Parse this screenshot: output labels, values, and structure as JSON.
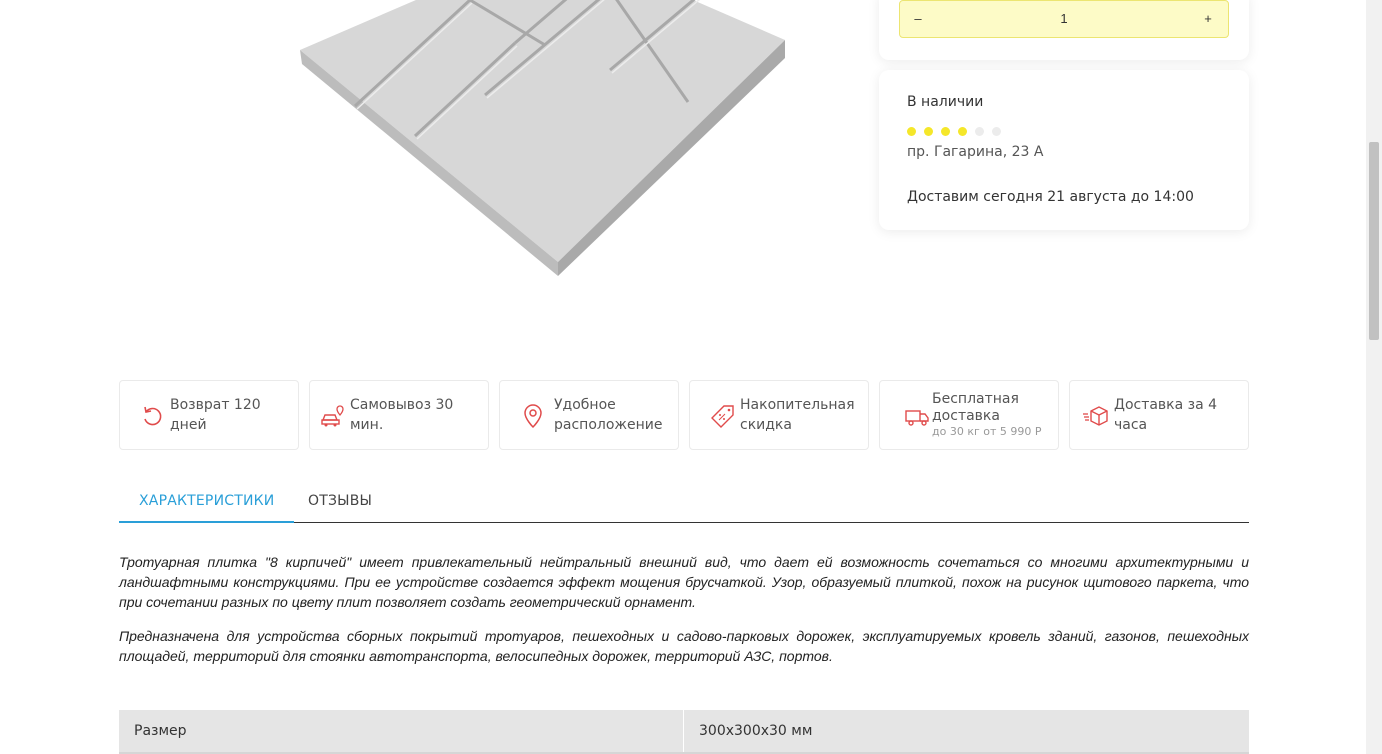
{
  "quantity": {
    "minus": "–",
    "value": "1",
    "plus": "+"
  },
  "availability": {
    "status": "В наличии",
    "stock_level": {
      "filled": 4,
      "total": 6
    },
    "address": "пр. Гагарина, 23 А",
    "delivery": "Доставим сегодня 21 августа до 14:00"
  },
  "colors": {
    "accent": "#2a9fd8",
    "stock_dot": "#f5e72a",
    "stepper_bg": "#fdfbc7",
    "icon": "#e04b4b"
  },
  "benefits": [
    {
      "icon": "return-icon",
      "label": "Возврат 120 дней"
    },
    {
      "icon": "car-location-icon",
      "label": "Самовывоз 30 мин."
    },
    {
      "icon": "location-pin-icon",
      "label": "Удобное расположение"
    },
    {
      "icon": "discount-tag-icon",
      "label": "Накопительная скидка"
    },
    {
      "icon": "delivery-truck-icon",
      "label": "Бесплатная доставка",
      "sublabel": "до 30 кг от 5 990 Р"
    },
    {
      "icon": "fast-box-icon",
      "label": "Доставка за 4 часа"
    }
  ],
  "tabs": [
    {
      "label": "ХАРАКТЕРИСТИКИ",
      "active": true
    },
    {
      "label": "ОТЗЫВЫ",
      "active": false
    }
  ],
  "description": [
    "Тротуарная плитка \"8 кирпичей\" имеет привлекательный нейтральный внешний вид, что дает ей возможность сочетаться со многими архитектурными и ландшафтными конструкциями. При ее устройстве создается эффект мощения брусчаткой. Узор, образуемый плиткой, похож на рисунок щитового паркета, что при сочетании разных по цвету плит позволяет создать геометрический орнамент.",
    "Предназначена для устройства сборных покрытий тротуаров, пешеходных и садово-парковых дорожек, эксплуатируемых кровель зданий, газонов, пешеходных площадей, территорий для стоянки автотранспорта, велосипедных дорожек, территорий АЗС, портов."
  ],
  "specs": [
    {
      "key": "Размер",
      "value": "300x300x30 мм"
    }
  ]
}
